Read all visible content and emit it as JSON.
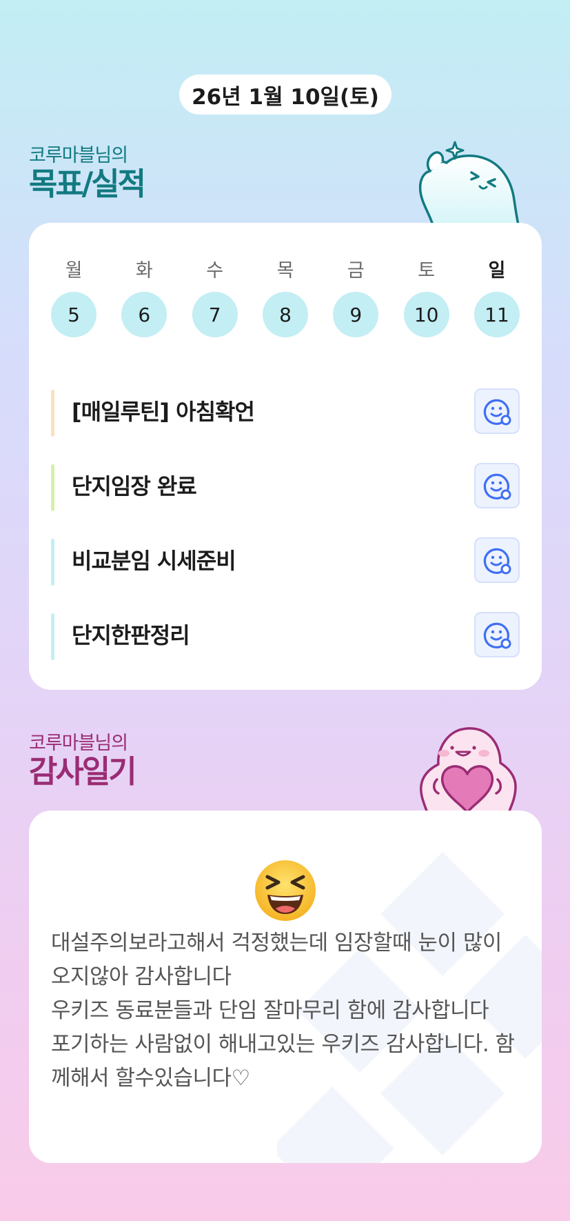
{
  "date": "26년 1월 10일(토)",
  "goals_section": {
    "subtitle": "코루마블님의",
    "title": "목표/실적"
  },
  "week": [
    {
      "day": "월",
      "num": "5"
    },
    {
      "day": "화",
      "num": "6"
    },
    {
      "day": "수",
      "num": "7"
    },
    {
      "day": "목",
      "num": "8"
    },
    {
      "day": "금",
      "num": "9"
    },
    {
      "day": "토",
      "num": "10"
    },
    {
      "day": "일",
      "num": "11"
    }
  ],
  "goals": [
    {
      "text": "[매일루틴] 아침확언",
      "color": "#fbe1bd"
    },
    {
      "text": "단지임장 완료",
      "color": "#d7f0aa"
    },
    {
      "text": "비교분임 시세준비",
      "color": "#c2eef4"
    },
    {
      "text": "단지한판정리",
      "color": "#c2eef4"
    }
  ],
  "thanks_section": {
    "subtitle": "코루마블님의",
    "title": "감사일기"
  },
  "thanks_lines": [
    "대설주의보라고해서 걱정했는데 임장할때 눈이 많이오지않아 감사합니다",
    "우키즈 동료분들과 단임 잘마무리 함에 감사합니다",
    "포기하는 사람없이 해내고있는 우키즈 감사합니다. 함께해서 할수있습니다♡"
  ],
  "colors": {
    "goal_accent": "#127a80",
    "thanks_accent": "#9a2c74",
    "day_circle": "#c2eef4",
    "check_icon": "#3f6ff2"
  },
  "icons": {
    "goal_action": "smile-badge-icon",
    "emoji": "laughing-emoji-icon"
  }
}
